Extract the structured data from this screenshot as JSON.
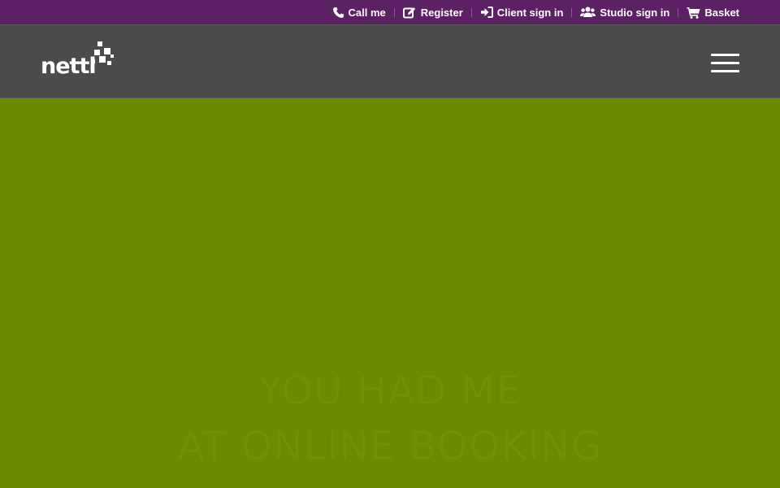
{
  "colors": {
    "topbar_bg": "#5c2164",
    "navbar_bg": "#4b4b4b",
    "hero_bg": "#6a8a00",
    "hero_text": "#6f8f05",
    "link_text": "#ffffff"
  },
  "topbar": {
    "items": [
      {
        "label": "Call me",
        "icon": "phone-icon"
      },
      {
        "label": "Register",
        "icon": "edit-icon"
      },
      {
        "label": "Client sign in",
        "icon": "sign-in-icon"
      },
      {
        "label": "Studio sign in",
        "icon": "users-icon"
      },
      {
        "label": "Basket",
        "icon": "cart-icon"
      }
    ]
  },
  "navbar": {
    "logo_text": "nettl",
    "menu_icon": "hamburger-menu-icon"
  },
  "hero": {
    "line1": "YOU HAD ME",
    "line2": "AT ONLINE BOOKING"
  }
}
